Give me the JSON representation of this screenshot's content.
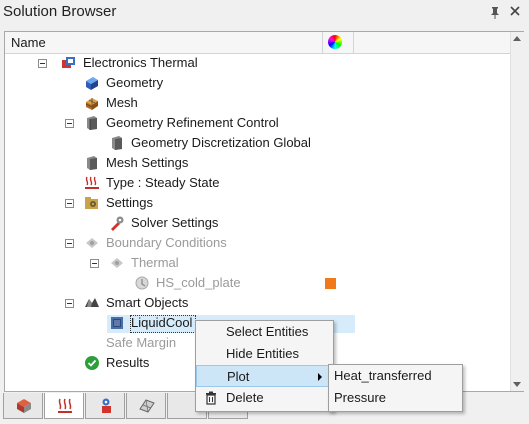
{
  "window": {
    "title": "Solution Browser"
  },
  "header": {
    "name_col": "Name",
    "color_col_icon": "color-wheel-icon"
  },
  "tree": {
    "root": {
      "label": "Electronics Thermal"
    },
    "geometry": {
      "label": "Geometry"
    },
    "mesh": {
      "label": "Mesh"
    },
    "grc": {
      "label": "Geometry Refinement Control"
    },
    "gdg": {
      "label": "Geometry Discretization Global"
    },
    "mesh_settings": {
      "label": "Mesh Settings"
    },
    "type": {
      "label": "Type : Steady State"
    },
    "settings": {
      "label": "Settings"
    },
    "solver_settings": {
      "label": "Solver Settings"
    },
    "bc": {
      "label": "Boundary Conditions"
    },
    "thermal": {
      "label": "Thermal"
    },
    "hs": {
      "label": "HS_cold_plate",
      "color": "#f07a1a"
    },
    "smart_objects": {
      "label": "Smart Objects"
    },
    "liquid": {
      "label": "LiquidCool"
    },
    "safe_margin": {
      "label": "Safe Margin"
    },
    "results": {
      "label": "Results"
    }
  },
  "context_menu": {
    "select_entities": "Select Entities",
    "hide_entities": "Hide Entities",
    "plot": "Plot",
    "delete": "Delete"
  },
  "plot_submenu": {
    "heat_transferred": "Heat_transferred",
    "pressure": "Pressure"
  },
  "colors": {
    "selection": "#d6ecfa",
    "menu_highlight": "#cde6f7",
    "accent_orange": "#f07a1a",
    "results_green": "#2e9e3a"
  }
}
